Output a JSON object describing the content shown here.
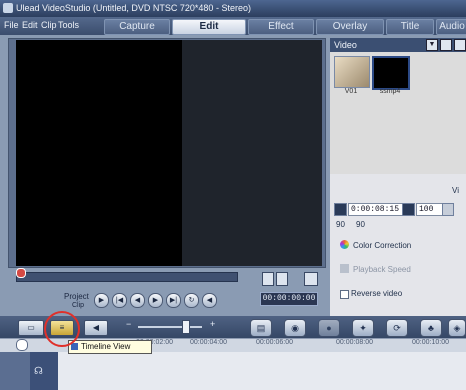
{
  "window": {
    "title": "Ulead VideoStudio (Untitled, DVD NTSC 720*480 - Stereo)"
  },
  "menu": [
    "File",
    "Edit",
    "Clip",
    "Tools"
  ],
  "tabs": [
    {
      "label": "Capture",
      "active": false
    },
    {
      "label": "Edit",
      "active": true
    },
    {
      "label": "Effect",
      "active": false
    },
    {
      "label": "Overlay",
      "active": false
    },
    {
      "label": "Title",
      "active": false
    },
    {
      "label": "Audio",
      "active": false
    }
  ],
  "library": {
    "category": "Video",
    "thumbnails": [
      {
        "label": "V01",
        "selected": false
      },
      {
        "label": "ssmp4",
        "selected": true
      }
    ]
  },
  "options": {
    "panel_label": "Vi",
    "duration": "0:00:08:15",
    "volume": "100",
    "color_correction": "Color Correction",
    "playback_speed": "Playback Speed",
    "reverse_video": "Reverse video",
    "rotate_left": "90",
    "rotate_right": "90"
  },
  "navigation": {
    "project_label": "Project",
    "clip_label": "Clip",
    "timecode": "00:00:00:00"
  },
  "toolbar": {
    "zoom_icon": "zoom-out-icon"
  },
  "timeline": {
    "ticks": [
      "00:00:02:00",
      "00:00:04:00",
      "00:00:06:00",
      "00:00:08:00",
      "00:00:10:00"
    ],
    "tooltip": "Timeline View"
  },
  "colors": {
    "accent": "#e0302a",
    "titlebar": "#2c3e5e"
  }
}
